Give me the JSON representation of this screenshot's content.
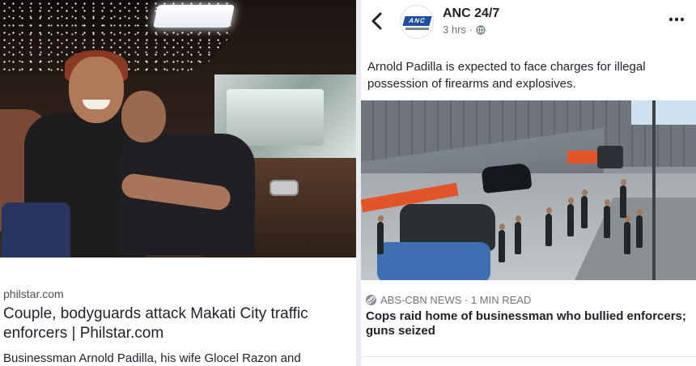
{
  "left_post": {
    "source": "philstar.com",
    "headline": "Couple, bodyguards attack Makati City traffic enforcers | Philstar.com",
    "description": "Businessman Arnold Padilla, his wife Glocel Razon and"
  },
  "right_post": {
    "page_name": "ANC 24/7",
    "avatar_logo": "ANC",
    "timestamp": "3 hrs",
    "dot": "·",
    "privacy_icon": "globe-icon",
    "post_text": "Arnold Padilla is expected to face charges for illegal possession of firearms and explosives.",
    "article": {
      "source": "ABS-CBN NEWS · 1 MIN READ",
      "title": "Cops raid home of businessman who bullied enforcers; guns seized"
    }
  },
  "icons": {
    "back": "chevron-left-icon",
    "more": "more-options-icon",
    "link": "link-icon"
  },
  "colors": {
    "text_primary": "#1d2129",
    "text_secondary": "#6e7479",
    "anc_blue": "#1e4fa0",
    "divider": "#e9ebee"
  }
}
